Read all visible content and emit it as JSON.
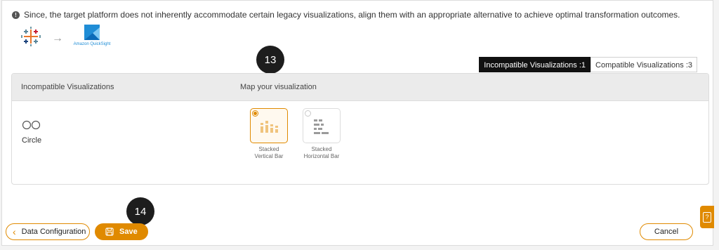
{
  "notice": {
    "icon": "info-circle-icon",
    "text": "Since, the target platform does not inherently accommodate certain legacy visualizations, align them with an appropriate alternative to achieve optimal transformation outcomes."
  },
  "platforms": {
    "source_logo": "tableau-logo",
    "arrow": "→",
    "target_logo": "amazon-quicksight-logo",
    "target_caption": "Amazon QuickSight"
  },
  "callouts": [
    "13",
    "14"
  ],
  "tabs": [
    {
      "label": "Incompatible Visualizations :1",
      "active": true
    },
    {
      "label": "Compatible Visualizations :3",
      "active": false
    }
  ],
  "table": {
    "headers": {
      "left": "Incompatible Visualizations",
      "right": "Map your visualization"
    },
    "row": {
      "viz_icon": "circle-icon",
      "viz_name": "Circle",
      "options": [
        {
          "label_line1": "Stacked",
          "label_line2": "Vertical Bar",
          "selected": true,
          "icon": "stacked-vertical-bar-icon"
        },
        {
          "label_line1": "Stacked",
          "label_line2": "Horizontal Bar",
          "selected": false,
          "icon": "stacked-horizontal-bar-icon"
        }
      ]
    }
  },
  "footer": {
    "back_label": "Data Configuration",
    "save_label": "Save",
    "cancel_label": "Cancel",
    "help_icon": "help-question-icon",
    "help_glyph": "?"
  },
  "colors": {
    "accent": "#e08a00",
    "selected_bg": "#fff9ef",
    "active_tab": "#111111",
    "quicksight_blue": "#1f8dd6"
  }
}
